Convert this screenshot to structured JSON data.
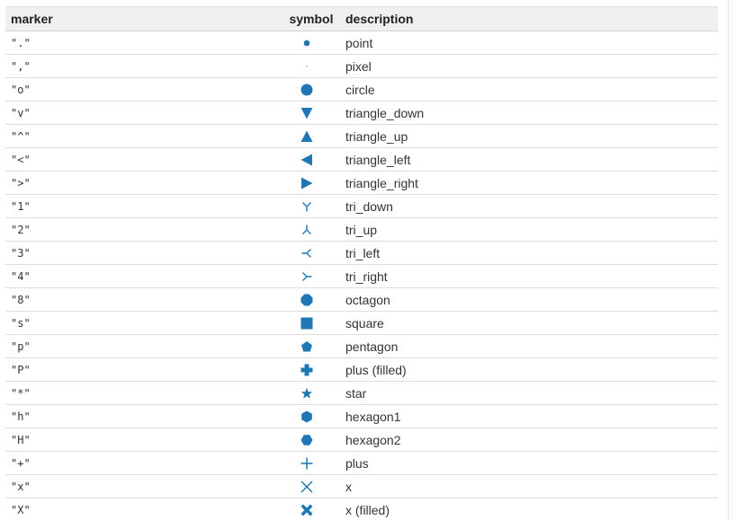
{
  "table": {
    "headers": {
      "marker": "marker",
      "symbol": "symbol",
      "description": "description"
    },
    "accent_color": "#1f77b4",
    "rows": [
      {
        "marker": "\".\"",
        "icon": "point",
        "description": "point"
      },
      {
        "marker": "\",\"",
        "icon": "pixel",
        "description": "pixel"
      },
      {
        "marker": "\"o\"",
        "icon": "circle",
        "description": "circle"
      },
      {
        "marker": "\"v\"",
        "icon": "triangle-down",
        "description": "triangle_down"
      },
      {
        "marker": "\"^\"",
        "icon": "triangle-up",
        "description": "triangle_up"
      },
      {
        "marker": "\"<\"",
        "icon": "triangle-left",
        "description": "triangle_left"
      },
      {
        "marker": "\">\"",
        "icon": "triangle-right",
        "description": "triangle_right"
      },
      {
        "marker": "\"1\"",
        "icon": "tri-down",
        "description": "tri_down"
      },
      {
        "marker": "\"2\"",
        "icon": "tri-up",
        "description": "tri_up"
      },
      {
        "marker": "\"3\"",
        "icon": "tri-left",
        "description": "tri_left"
      },
      {
        "marker": "\"4\"",
        "icon": "tri-right",
        "description": "tri_right"
      },
      {
        "marker": "\"8\"",
        "icon": "octagon",
        "description": "octagon"
      },
      {
        "marker": "\"s\"",
        "icon": "square",
        "description": "square"
      },
      {
        "marker": "\"p\"",
        "icon": "pentagon",
        "description": "pentagon"
      },
      {
        "marker": "\"P\"",
        "icon": "plus-filled",
        "description": "plus (filled)"
      },
      {
        "marker": "\"*\"",
        "icon": "star",
        "description": "star"
      },
      {
        "marker": "\"h\"",
        "icon": "hexagon1",
        "description": "hexagon1"
      },
      {
        "marker": "\"H\"",
        "icon": "hexagon2",
        "description": "hexagon2"
      },
      {
        "marker": "\"+\"",
        "icon": "plus",
        "description": "plus"
      },
      {
        "marker": "\"x\"",
        "icon": "x",
        "description": "x"
      },
      {
        "marker": "\"X\"",
        "icon": "x-filled",
        "description": "x (filled)"
      }
    ]
  }
}
